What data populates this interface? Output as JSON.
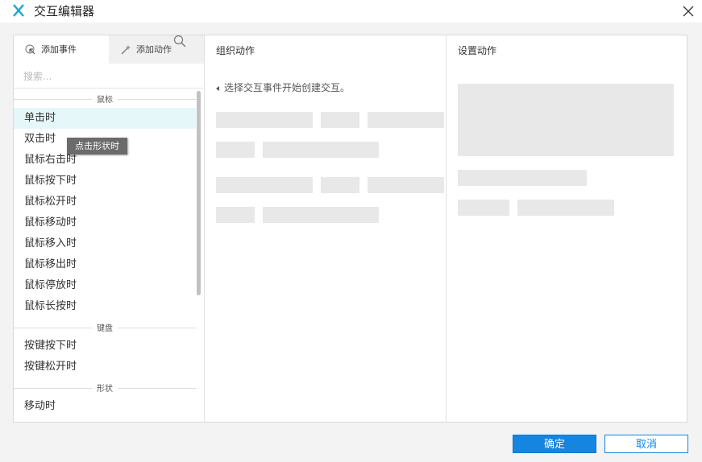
{
  "window": {
    "title": "交互编辑器"
  },
  "tabs": [
    {
      "label": "添加事件",
      "icon": "cursor-click-icon",
      "active": true
    },
    {
      "label": "添加动作",
      "icon": "sparkle-wand-icon",
      "active": false
    }
  ],
  "search": {
    "placeholder": "搜索..."
  },
  "groups": {
    "mouse": "鼠标",
    "keyboard": "键盘",
    "shape": "形状"
  },
  "mouse_events": [
    "单击时",
    "双击时",
    "鼠标右击时",
    "鼠标按下时",
    "鼠标松开时",
    "鼠标移动时",
    "鼠标移入时",
    "鼠标移出时",
    "鼠标停放时",
    "鼠标长按时"
  ],
  "keyboard_events": [
    "按键按下时",
    "按键松开时"
  ],
  "shape_events": [
    "移动时"
  ],
  "tooltip": "点击形状时",
  "middle": {
    "header": "组织动作",
    "hint": "选择交互事件开始创建交互。"
  },
  "right": {
    "header": "设置动作"
  },
  "buttons": {
    "ok": "确定",
    "cancel": "取消"
  },
  "colors": {
    "accent": "#1585e0",
    "selected_row": "#e6f7f9",
    "logo": "#1aa7c6"
  }
}
